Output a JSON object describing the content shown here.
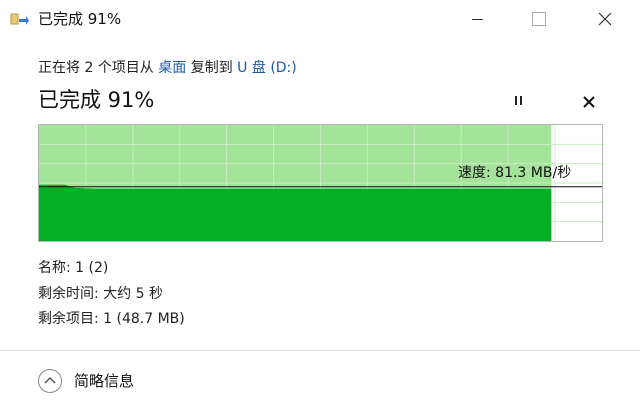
{
  "window": {
    "title": "已完成 91%",
    "minimize_icon": "minimize-icon",
    "maximize_icon": "maximize-icon",
    "close_icon": "close-icon"
  },
  "header": {
    "subtitle_prefix": "正在将 2 个项目从 ",
    "source": "桌面",
    "subtitle_middle": " 复制到 ",
    "destination": "U 盘 (D:)",
    "percent_text": "已完成 91%"
  },
  "controls": {
    "pause_icon": "pause-icon",
    "cancel_icon": "close-icon"
  },
  "progress": {
    "fraction": 0.91,
    "fill_color": "#a4e39a",
    "throughput_color": "#06b025",
    "speed_text": "速度: 81.3 MB/秒"
  },
  "details": {
    "name": "名称: 1 (2)",
    "time_remaining": "剩余时间: 大约 5 秒",
    "items_remaining": "剩余项目: 1 (48.7 MB)"
  },
  "footer": {
    "toggle_icon": "chevron-up-icon",
    "label": "简略信息"
  }
}
